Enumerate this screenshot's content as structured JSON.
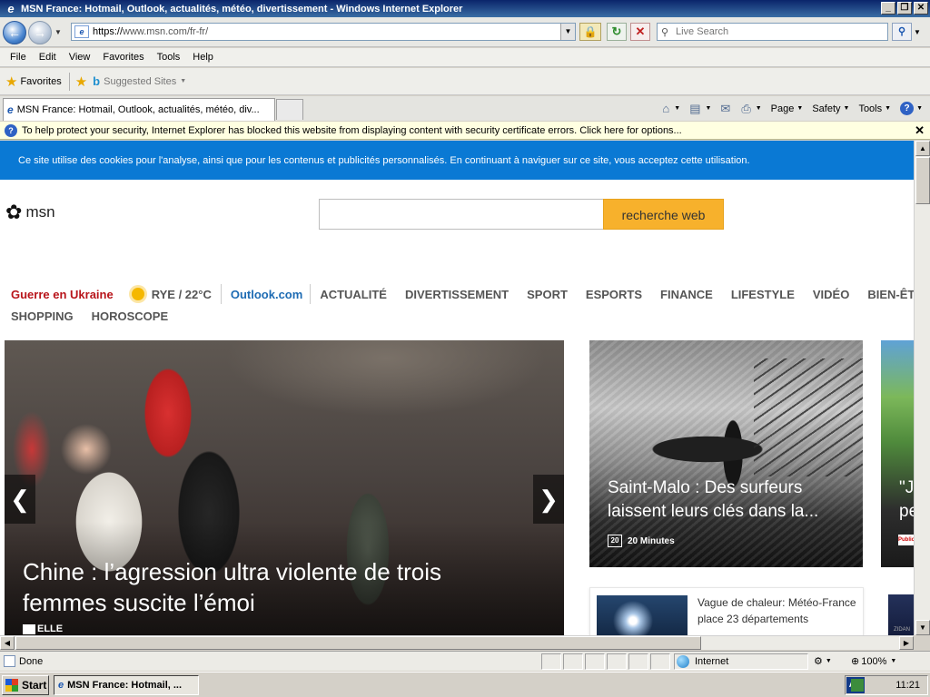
{
  "window": {
    "title": "MSN France: Hotmail, Outlook, actualités, météo, divertissement - Windows Internet Explorer",
    "minimize": "_",
    "restore": "❐",
    "close": "✕"
  },
  "address": {
    "url_prefix": "https://",
    "url_host": "www.msn.com",
    "url_path": "/fr-fr/",
    "search_placeholder": "Live Search"
  },
  "menu": [
    "File",
    "Edit",
    "View",
    "Favorites",
    "Tools",
    "Help"
  ],
  "favorites": {
    "label": "Favorites",
    "suggested": "Suggested Sites"
  },
  "tab": {
    "title": "MSN France: Hotmail, Outlook, actualités, météo, div..."
  },
  "commands": {
    "page": "Page",
    "safety": "Safety",
    "tools": "Tools"
  },
  "infobar": {
    "message": "To help protect your security, Internet Explorer has blocked this website from displaying content with security certificate errors. Click here for options..."
  },
  "page": {
    "cookie": "Ce site utilise des cookies pour l'analyse, ainsi que pour les contenus et publicités personnalisés. En continuant à naviguer sur ce site, vous acceptez cette utilisation.",
    "logo": "msn",
    "search_button": "recherche web",
    "nav_row1": {
      "ukraine": "Guerre en Ukraine",
      "weather": "RYE / 22°C",
      "outlook": "Outlook.com",
      "items": [
        "ACTUALITÉ",
        "DIVERTISSEMENT",
        "SPORT",
        "ESPORTS",
        "FINANCE",
        "LIFESTYLE",
        "VIDÉO",
        "BIEN-ÊTRE"
      ]
    },
    "nav_row2": [
      "SHOPPING",
      "HOROSCOPE"
    ],
    "hero": {
      "headline": "Chine : l’agression ultra violente de trois femmes suscite l’émoi",
      "source": "ELLE"
    },
    "card2": {
      "headline": "Saint-Malo : Des surfeurs laissent leurs clés dans la...",
      "source": "20 Minutes",
      "source_logo": "20"
    },
    "card3": {
      "partial_headline": "\"J\npe",
      "source_logo": "Public"
    },
    "card4": {
      "text": "Vague de chaleur: Météo-France place 23 départements"
    },
    "card5": {
      "logo": "ZIDAN"
    }
  },
  "status": {
    "text": "Done",
    "zone": "Internet",
    "zoom": "100%"
  },
  "taskbar": {
    "start": "Start",
    "task": "MSN France: Hotmail, ...",
    "lang": "AR",
    "time": "11:21"
  }
}
